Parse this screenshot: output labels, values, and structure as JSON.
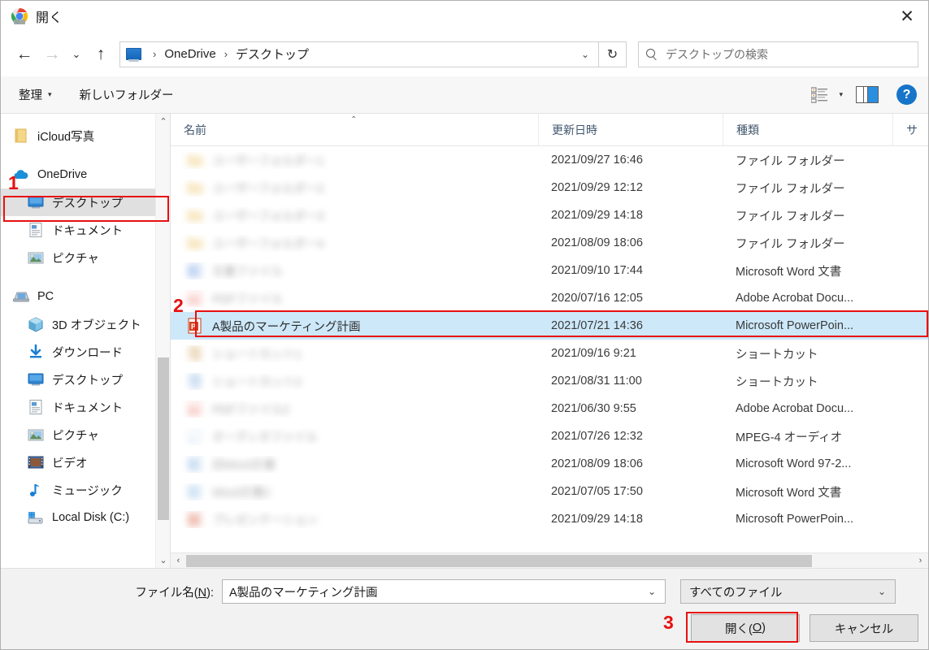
{
  "window": {
    "title": "開く",
    "app_icon": "chrome-icon",
    "close_label": "✕"
  },
  "nav": {
    "back_label": "←",
    "forward_label": "→",
    "recent_label": "⌄",
    "up_label": "↑",
    "refresh_label": "↻",
    "address_dropdown": "⌄",
    "breadcrumbs": [
      "OneDrive",
      "デスクトップ"
    ],
    "separator": "›",
    "search": {
      "placeholder": "デスクトップの検索",
      "icon": "search-icon"
    }
  },
  "commandbar": {
    "organize_label": "整理",
    "organize_caret": "▾",
    "new_folder_label": "新しいフォルダー",
    "view_caret": "▾",
    "help_label": "?"
  },
  "sidebar": {
    "groups": [
      {
        "items": [
          {
            "label": "iCloud写真",
            "icon": "icloud-photos-icon",
            "indent": false,
            "selected": false
          }
        ]
      },
      {
        "items": [
          {
            "label": "OneDrive",
            "icon": "onedrive-cloud-icon",
            "indent": false,
            "selected": false
          },
          {
            "label": "デスクトップ",
            "icon": "desktop-icon",
            "indent": true,
            "selected": true
          },
          {
            "label": "ドキュメント",
            "icon": "documents-icon",
            "indent": true,
            "selected": false
          },
          {
            "label": "ピクチャ",
            "icon": "pictures-icon",
            "indent": true,
            "selected": false
          }
        ]
      },
      {
        "items": [
          {
            "label": "PC",
            "icon": "pc-icon",
            "indent": false,
            "selected": false
          },
          {
            "label": "3D オブジェクト",
            "icon": "3d-objects-icon",
            "indent": true,
            "selected": false
          },
          {
            "label": "ダウンロード",
            "icon": "downloads-icon",
            "indent": true,
            "selected": false
          },
          {
            "label": "デスクトップ",
            "icon": "desktop-icon",
            "indent": true,
            "selected": false
          },
          {
            "label": "ドキュメント",
            "icon": "documents-icon",
            "indent": true,
            "selected": false
          },
          {
            "label": "ピクチャ",
            "icon": "pictures-icon",
            "indent": true,
            "selected": false
          },
          {
            "label": "ビデオ",
            "icon": "videos-icon",
            "indent": true,
            "selected": false
          },
          {
            "label": "ミュージック",
            "icon": "music-icon",
            "indent": true,
            "selected": false
          },
          {
            "label": "Local Disk (C:)",
            "icon": "local-disk-icon",
            "indent": true,
            "selected": false
          }
        ]
      }
    ],
    "scroll_up": "⌃",
    "scroll_down": "⌄"
  },
  "filelist": {
    "columns": [
      {
        "label": "名前",
        "sorted": true,
        "sort_caret": "⌃"
      },
      {
        "label": "更新日時",
        "sorted": false,
        "sort_caret": ""
      },
      {
        "label": "種類",
        "sorted": false,
        "sort_caret": ""
      },
      {
        "label": "サ",
        "sorted": false,
        "sort_caret": ""
      }
    ],
    "rows": [
      {
        "name": "ユーザーフォルダー1",
        "date": "2021/09/27 16:46",
        "type": "ファイル フォルダー",
        "icon": "folder-icon",
        "icon_color": "#f3d48a",
        "redacted": true,
        "selected": false
      },
      {
        "name": "ユーザーフォルダー2",
        "date": "2021/09/29 12:12",
        "type": "ファイル フォルダー",
        "icon": "folder-icon",
        "icon_color": "#f3d48a",
        "redacted": true,
        "selected": false
      },
      {
        "name": "ユーザーフォルダー3",
        "date": "2021/09/29 14:18",
        "type": "ファイル フォルダー",
        "icon": "folder-icon",
        "icon_color": "#f3d48a",
        "redacted": true,
        "selected": false
      },
      {
        "name": "ユーザーフォルダー4",
        "date": "2021/08/09 18:06",
        "type": "ファイル フォルダー",
        "icon": "folder-icon",
        "icon_color": "#f3d48a",
        "redacted": true,
        "selected": false
      },
      {
        "name": "文書ファイル",
        "date": "2021/09/10 17:44",
        "type": "Microsoft Word 文書",
        "icon": "word-icon",
        "icon_color": "#3b78d8",
        "redacted": true,
        "selected": false
      },
      {
        "name": "PDFファイル",
        "date": "2020/07/16 12:05",
        "type": "Adobe Acrobat Docu...",
        "icon": "pdf-icon",
        "icon_color": "#e8645a",
        "redacted": true,
        "selected": false
      },
      {
        "name": "A製品のマーケティング計画",
        "date": "2021/07/21 14:36",
        "type": "Microsoft PowerPoin...",
        "icon": "powerpoint-icon",
        "icon_color": "#d24726",
        "redacted": false,
        "selected": true
      },
      {
        "name": "ショートカット1",
        "date": "2021/09/16 9:21",
        "type": "ショートカット",
        "icon": "shortcut-icon",
        "icon_color": "#d6a96a",
        "redacted": true,
        "selected": false
      },
      {
        "name": "ショートカット2",
        "date": "2021/08/31 11:00",
        "type": "ショートカット",
        "icon": "shortcut-icon",
        "icon_color": "#8ab4e0",
        "redacted": true,
        "selected": false
      },
      {
        "name": "PDFファイル2",
        "date": "2021/06/30 9:55",
        "type": "Adobe Acrobat Docu...",
        "icon": "pdf-icon",
        "icon_color": "#e8645a",
        "redacted": true,
        "selected": false
      },
      {
        "name": "オーディオファイル",
        "date": "2021/07/26 12:32",
        "type": "MPEG-4 オーディオ",
        "icon": "audio-icon",
        "icon_color": "#a8c8ea",
        "redacted": true,
        "selected": false
      },
      {
        "name": "旧Word文書",
        "date": "2021/08/09 18:06",
        "type": "Microsoft Word 97-2...",
        "icon": "word-icon",
        "icon_color": "#5b9bd5",
        "redacted": true,
        "selected": false
      },
      {
        "name": "Word文書2",
        "date": "2021/07/05 17:50",
        "type": "Microsoft Word 文書",
        "icon": "word-icon",
        "icon_color": "#6aa8dd",
        "redacted": true,
        "selected": false
      },
      {
        "name": "プレゼンテーション",
        "date": "2021/09/29 14:18",
        "type": "Microsoft PowerPoin...",
        "icon": "powerpoint-icon",
        "icon_color": "#e8845a",
        "redacted": true,
        "selected": false
      }
    ],
    "hscroll_left": "‹",
    "hscroll_right": "›"
  },
  "footer": {
    "filename_label_prefix": "ファイル名(",
    "filename_label_key": "N",
    "filename_label_suffix": "):",
    "filename_value": "A製品のマーケティング計画",
    "filename_caret": "⌄",
    "filter_value": "すべてのファイル",
    "filter_caret": "⌄",
    "open_label_prefix": "開く(",
    "open_label_key": "O",
    "open_label_suffix": ")",
    "cancel_label": "キャンセル"
  },
  "annotations": {
    "markers": [
      {
        "number": "1",
        "target": "sidebar-desktop"
      },
      {
        "number": "2",
        "target": "file-row-selected"
      },
      {
        "number": "3",
        "target": "open-button"
      }
    ],
    "color": "#e81010"
  }
}
